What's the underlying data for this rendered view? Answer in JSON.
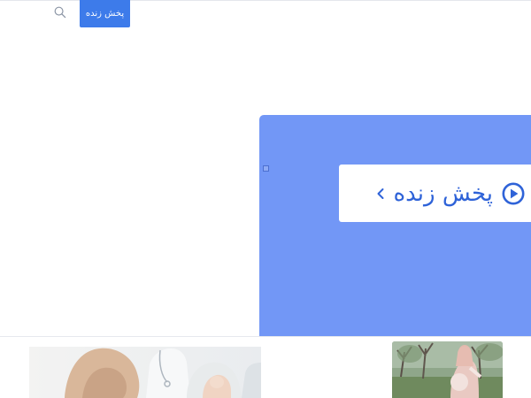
{
  "header": {
    "live_button_label": "پخش زنده",
    "search_icon": "search-icon"
  },
  "banner": {
    "background_color": "#7297f6",
    "card": {
      "label": "پخش زنده",
      "play_icon": "play-circle-icon",
      "chevron_icon": "chevron-left-icon",
      "text_color": "#2f63d8"
    }
  },
  "articles": [
    {
      "image": "doctor-with-patient-photo"
    },
    {
      "image": "pregnant-woman-outdoors-photo"
    }
  ],
  "colors": {
    "accent": "#3d7bea"
  }
}
